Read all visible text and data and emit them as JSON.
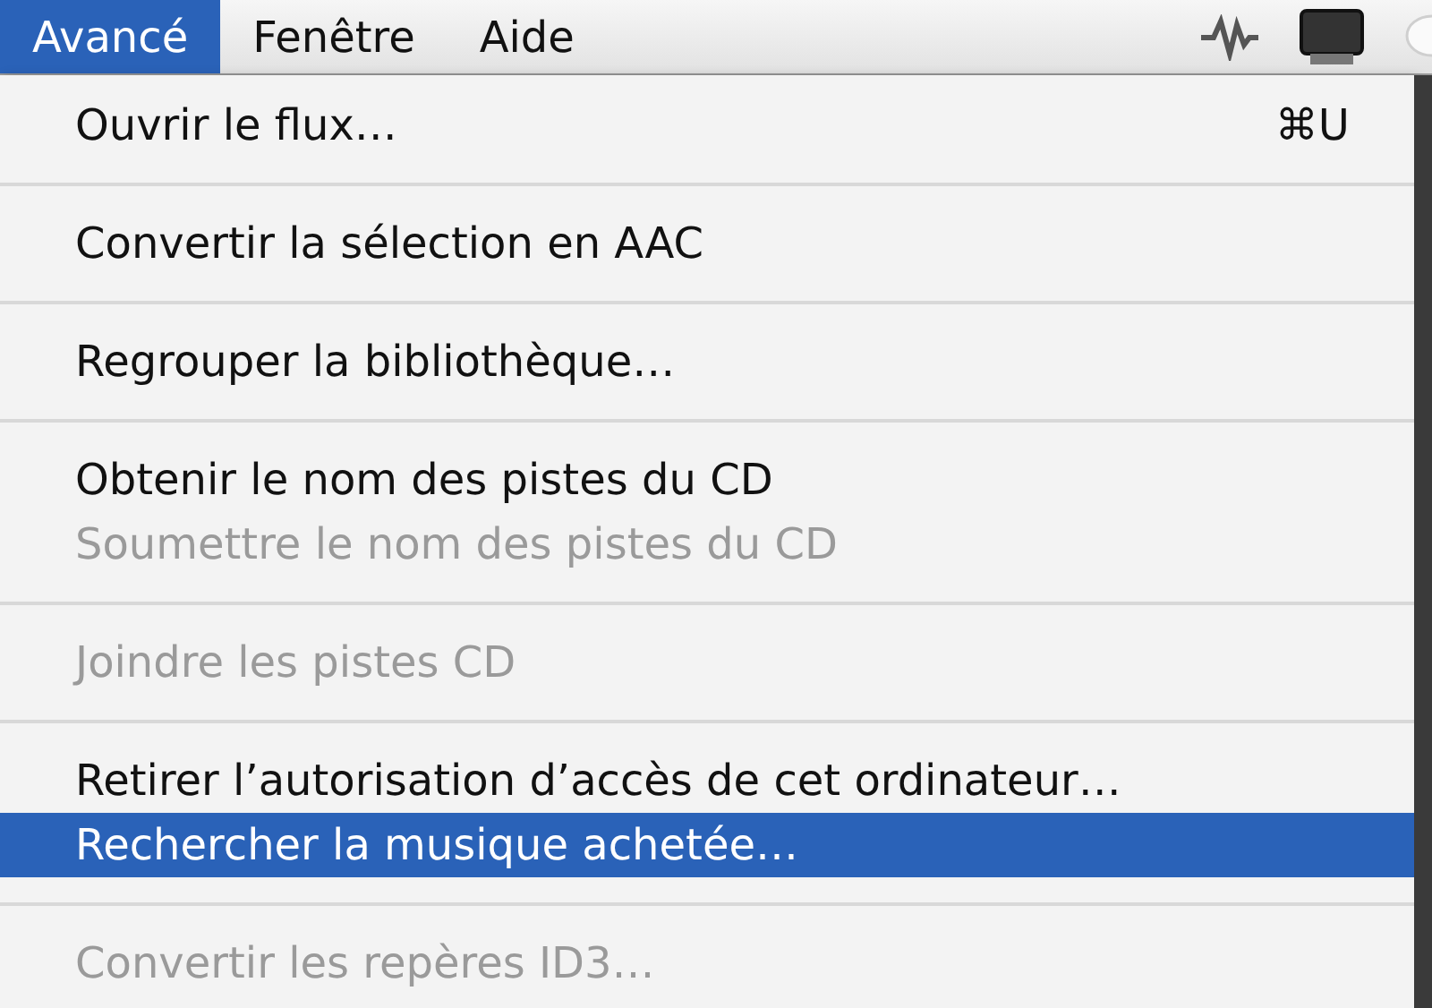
{
  "menubar": {
    "items": [
      {
        "label": "Avancé",
        "selected": true
      },
      {
        "label": "Fenêtre",
        "selected": false
      },
      {
        "label": "Aide",
        "selected": false
      }
    ]
  },
  "menu": {
    "items": [
      {
        "kind": "item",
        "label": "Ouvrir le flux…",
        "shortcut": "⌘U",
        "disabled": false,
        "selected": false
      },
      {
        "kind": "separator"
      },
      {
        "kind": "item",
        "label": "Convertir la sélection en AAC",
        "disabled": false,
        "selected": false
      },
      {
        "kind": "separator"
      },
      {
        "kind": "item",
        "label": "Regrouper la bibliothèque…",
        "disabled": false,
        "selected": false
      },
      {
        "kind": "separator"
      },
      {
        "kind": "item",
        "label": "Obtenir le nom des pistes du CD",
        "disabled": false,
        "selected": false
      },
      {
        "kind": "item",
        "label": "Soumettre le nom des pistes du CD",
        "disabled": true,
        "selected": false
      },
      {
        "kind": "separator"
      },
      {
        "kind": "item",
        "label": "Joindre les pistes CD",
        "disabled": true,
        "selected": false
      },
      {
        "kind": "separator"
      },
      {
        "kind": "item",
        "label": "Retirer l’autorisation d’accès de cet ordinateur…",
        "disabled": false,
        "selected": false
      },
      {
        "kind": "item",
        "label": "Rechercher la musique achetée…",
        "disabled": false,
        "selected": true
      },
      {
        "kind": "separator"
      },
      {
        "kind": "item",
        "label": "Convertir les repères ID3…",
        "disabled": true,
        "selected": false
      }
    ]
  }
}
